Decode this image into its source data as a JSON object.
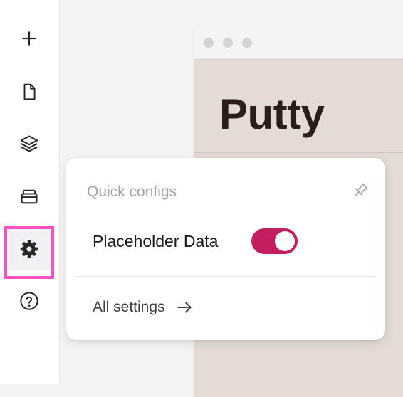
{
  "sidebar": {
    "items": [
      {
        "name": "add",
        "icon": "plus-icon"
      },
      {
        "name": "pages",
        "icon": "file-icon"
      },
      {
        "name": "layers",
        "icon": "layers-icon"
      },
      {
        "name": "assets",
        "icon": "archive-icon"
      },
      {
        "name": "settings",
        "icon": "gear-icon",
        "active": true
      },
      {
        "name": "help",
        "icon": "help-circle-icon"
      }
    ],
    "highlight_color": "#ff4fc6"
  },
  "preview": {
    "title": "Putty",
    "background": "#e3dbd5"
  },
  "popover": {
    "title": "Quick configs",
    "pin_icon": "pin-icon",
    "configs": [
      {
        "label": "Placeholder Data",
        "enabled": true
      }
    ],
    "all_settings_label": "All settings",
    "arrow_icon": "arrow-right-icon"
  },
  "colors": {
    "toggle_on": "#c41e5e"
  }
}
